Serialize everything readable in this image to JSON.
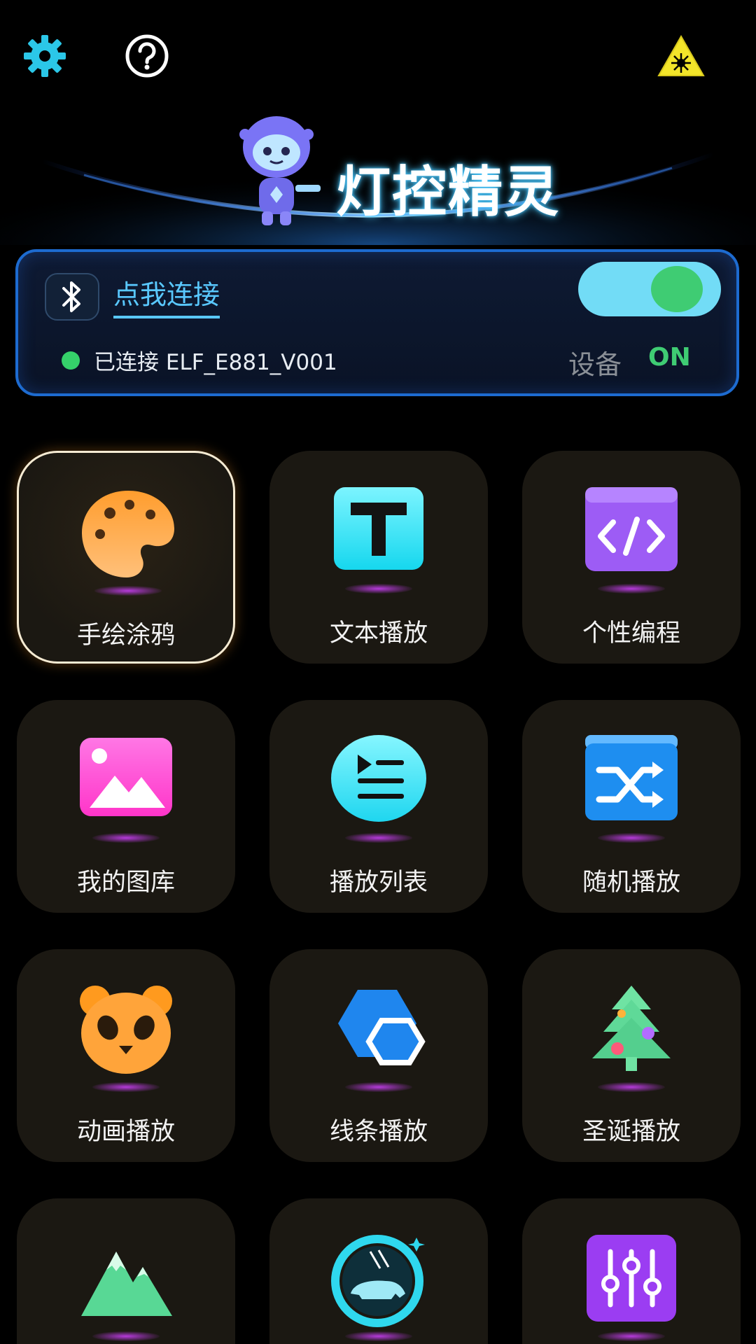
{
  "header": {
    "settings_icon": "gear-icon",
    "help_icon": "question-circle-icon",
    "laser_icon": "laser-warning-icon"
  },
  "banner": {
    "title": "灯控精灵",
    "mascot_icon": "robot-mascot"
  },
  "connection": {
    "connect_label": "点我连接",
    "status_text": "已连接 ELF_E881_V001",
    "device_label": "设备",
    "device_state": "ON",
    "toggle_on": true,
    "colors": {
      "accent": "#59c8ff",
      "on": "#3fcc73",
      "card_border": "#1d6bd0"
    }
  },
  "tiles": [
    {
      "label": "手绘涂鸦",
      "icon": "palette-icon",
      "active": true
    },
    {
      "label": "文本播放",
      "icon": "text-t-icon"
    },
    {
      "label": "个性编程",
      "icon": "code-window-icon"
    },
    {
      "label": "我的图库",
      "icon": "gallery-icon"
    },
    {
      "label": "播放列表",
      "icon": "playlist-icon"
    },
    {
      "label": "随机播放",
      "icon": "shuffle-icon"
    },
    {
      "label": "动画播放",
      "icon": "panda-icon"
    },
    {
      "label": "线条播放",
      "icon": "hexagon-lines-icon"
    },
    {
      "label": "圣诞播放",
      "icon": "christmas-tree-icon"
    },
    {
      "label": "",
      "icon": "mountains-icon"
    },
    {
      "label": "",
      "icon": "polar-bear-meteor-icon"
    },
    {
      "label": "",
      "icon": "equalizer-icon"
    }
  ]
}
